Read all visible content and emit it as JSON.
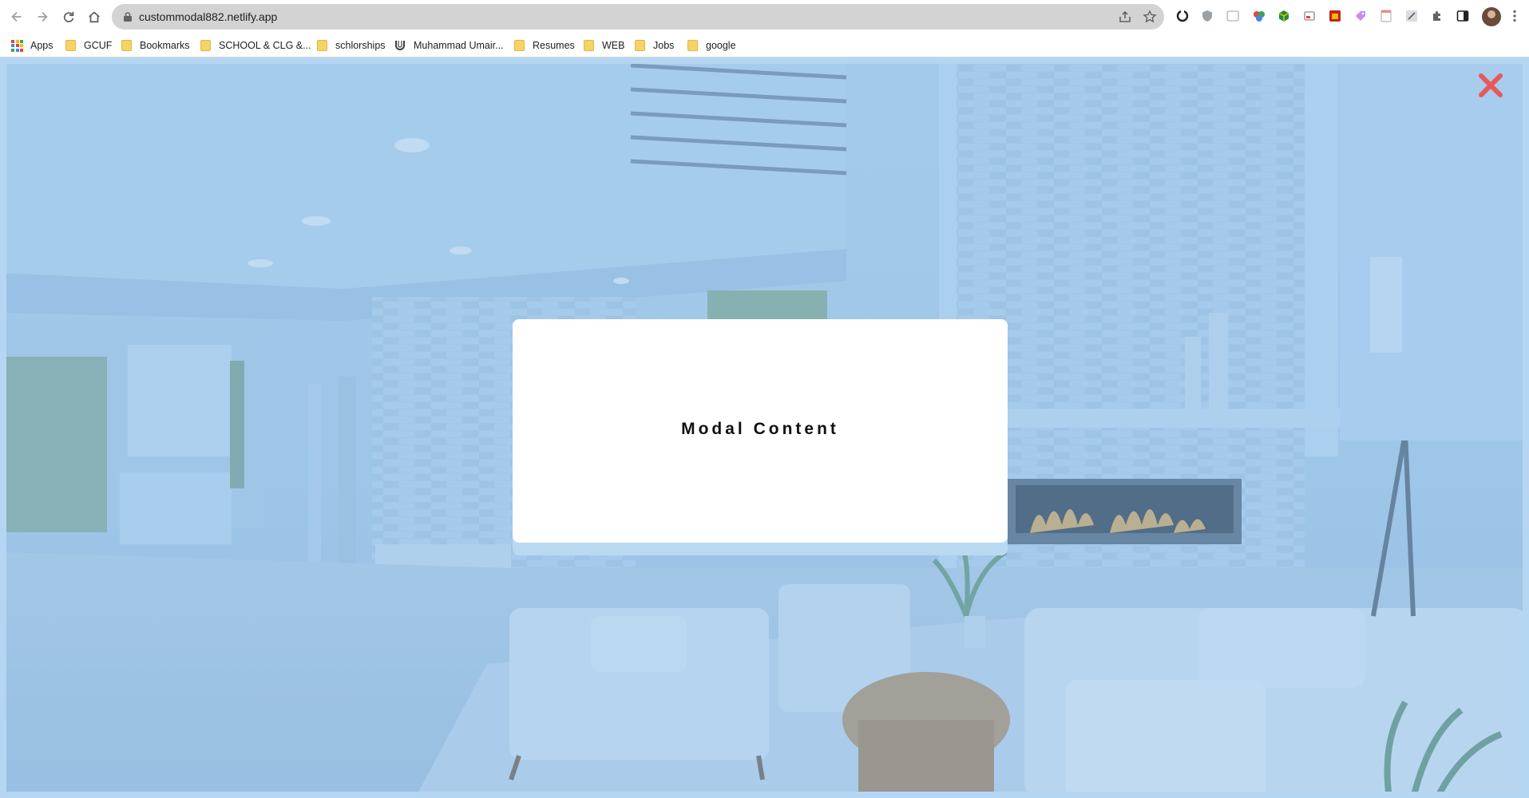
{
  "browser": {
    "url": "custommodal882.netlify.app",
    "nav_icons": [
      "back-icon",
      "forward-icon",
      "reload-icon",
      "home-icon"
    ],
    "bookmarks": [
      {
        "label": "Apps",
        "icon": "apps-icon"
      },
      {
        "label": "GCUF",
        "icon": "folder-icon"
      },
      {
        "label": "Bookmarks",
        "icon": "folder-icon"
      },
      {
        "label": "SCHOOL & CLG &...",
        "icon": "folder-icon"
      },
      {
        "label": "schlorships",
        "icon": "folder-icon"
      },
      {
        "label": "Muhammad Umair...",
        "icon": "u-logo-icon"
      },
      {
        "label": "Resumes",
        "icon": "folder-icon"
      },
      {
        "label": "WEB",
        "icon": "folder-icon"
      },
      {
        "label": "Jobs",
        "icon": "folder-icon"
      },
      {
        "label": "google",
        "icon": "folder-icon"
      }
    ]
  },
  "page": {
    "modal": {
      "content": "Modal Content"
    },
    "close_icon": "close-x-icon",
    "colors": {
      "overlay": "#a9cdea",
      "close": "#e8585a",
      "modal_bg": "#ffffff"
    }
  }
}
